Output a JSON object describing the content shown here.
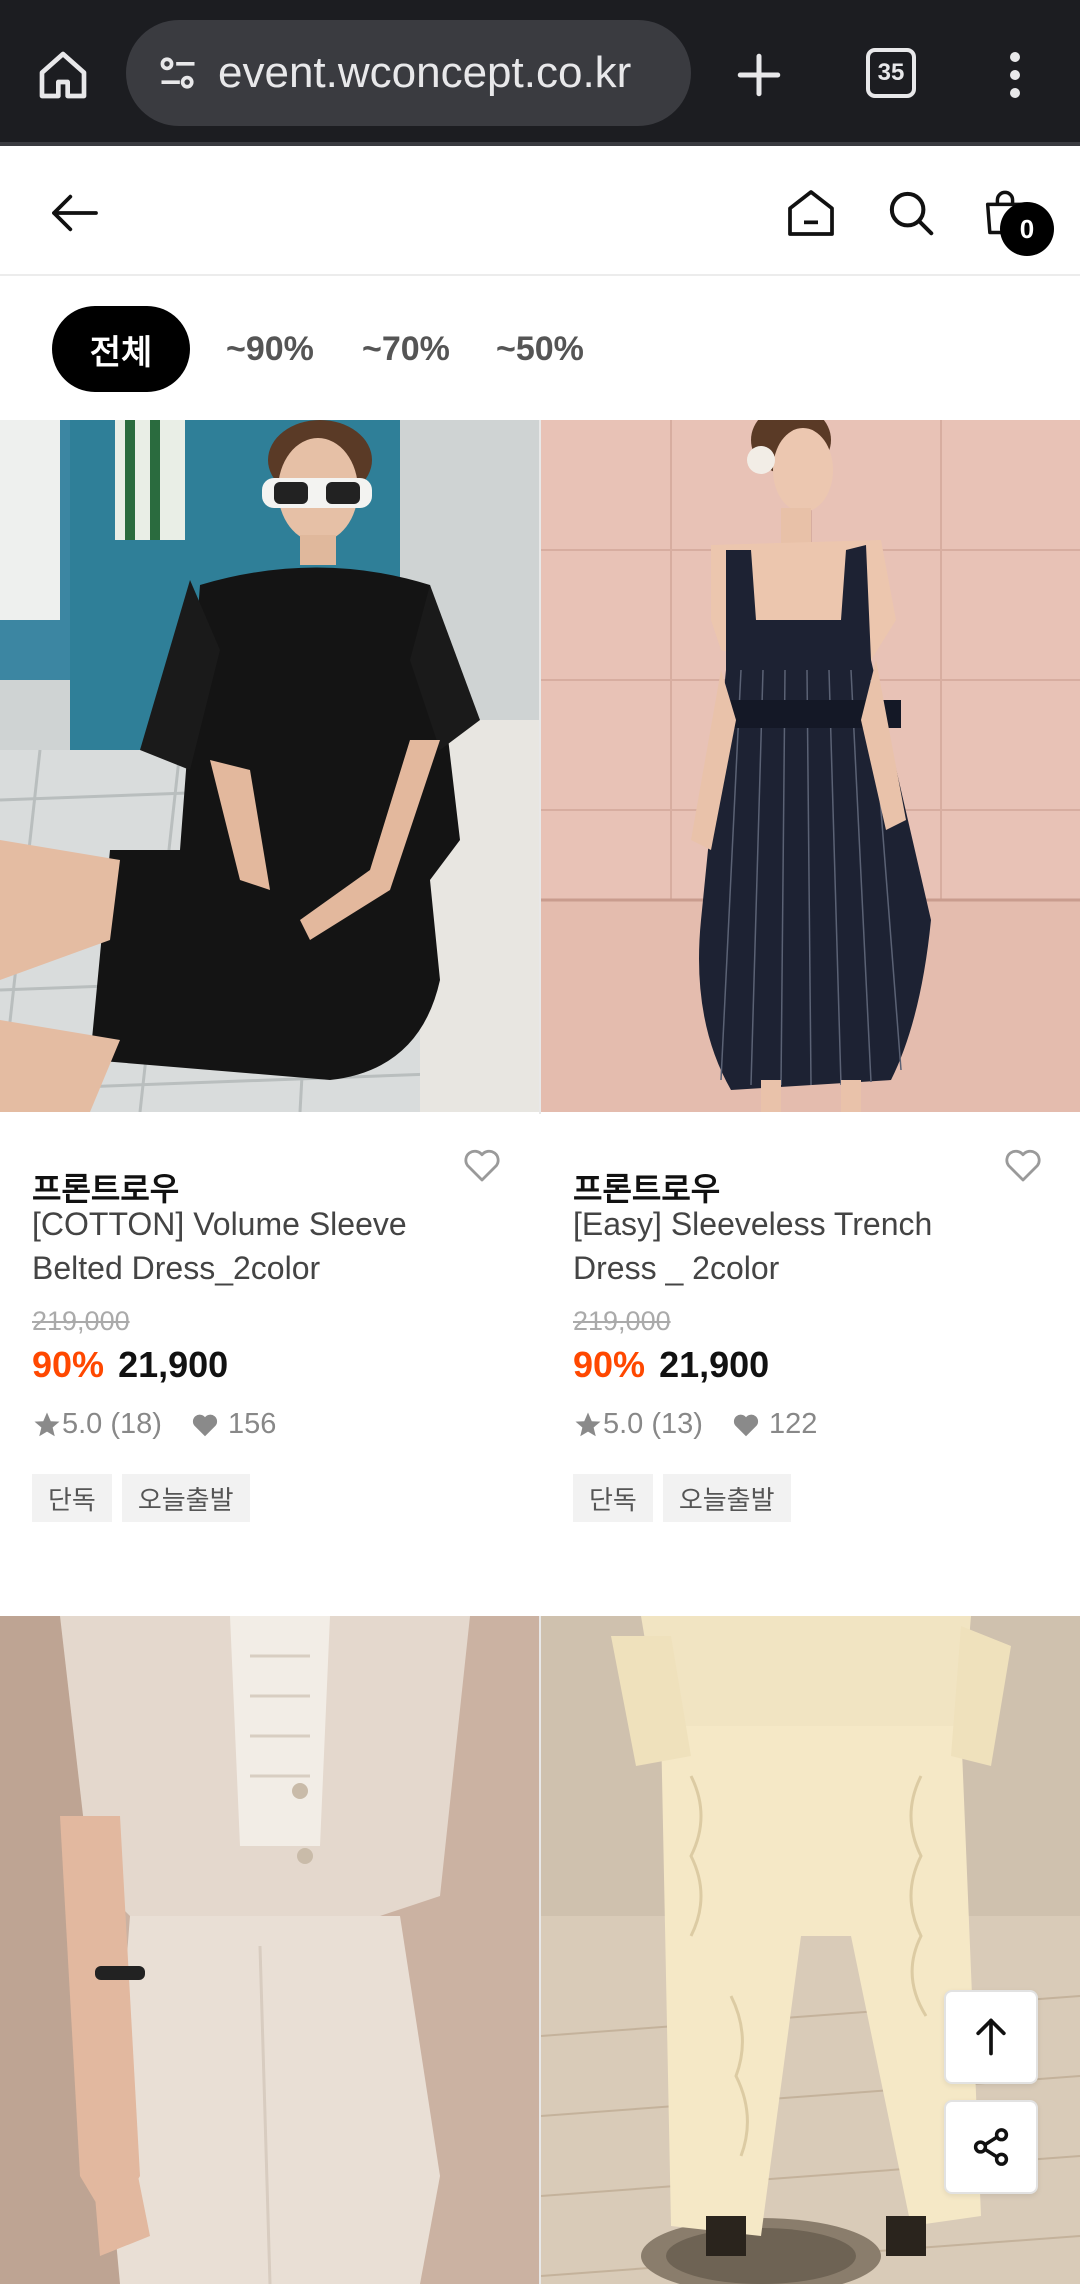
{
  "browser": {
    "url": "event.wconcept.co.kr",
    "tab_count": "35"
  },
  "header": {
    "cart_count": "0"
  },
  "filters": {
    "active": "전체",
    "options": [
      "~90%",
      "~70%",
      "~50%"
    ]
  },
  "products": [
    {
      "brand": "프론트로우",
      "name_line1": "[COTTON] Volume Sleeve",
      "name_line2": "Belted Dress_2color",
      "original_price": "219,000",
      "discount": "90%",
      "sale_price": "21,900",
      "rating": "5.0",
      "review_count": "(18)",
      "likes": "156",
      "tags": [
        "단독",
        "오늘출발"
      ]
    },
    {
      "brand": "프론트로우",
      "name_line1": "[Easy] Sleeveless Trench",
      "name_line2": "Dress _ 2color",
      "original_price": "219,000",
      "discount": "90%",
      "sale_price": "21,900",
      "rating": "5.0",
      "review_count": "(13)",
      "likes": "122",
      "tags": [
        "단독",
        "오늘출발"
      ]
    }
  ],
  "colors": {
    "chrome_bg": "#1c1d21",
    "discount": "#ff4800",
    "chip_active_bg": "#000000"
  },
  "icons": [
    "home-icon",
    "site-settings-icon",
    "plus-icon",
    "tab-switcher-icon",
    "kebab-menu-icon",
    "back-arrow-icon",
    "home-outline-icon",
    "search-icon",
    "shopping-bag-icon",
    "heart-outline-icon",
    "star-icon",
    "heart-filled-icon",
    "arrow-up-icon",
    "share-icon"
  ]
}
